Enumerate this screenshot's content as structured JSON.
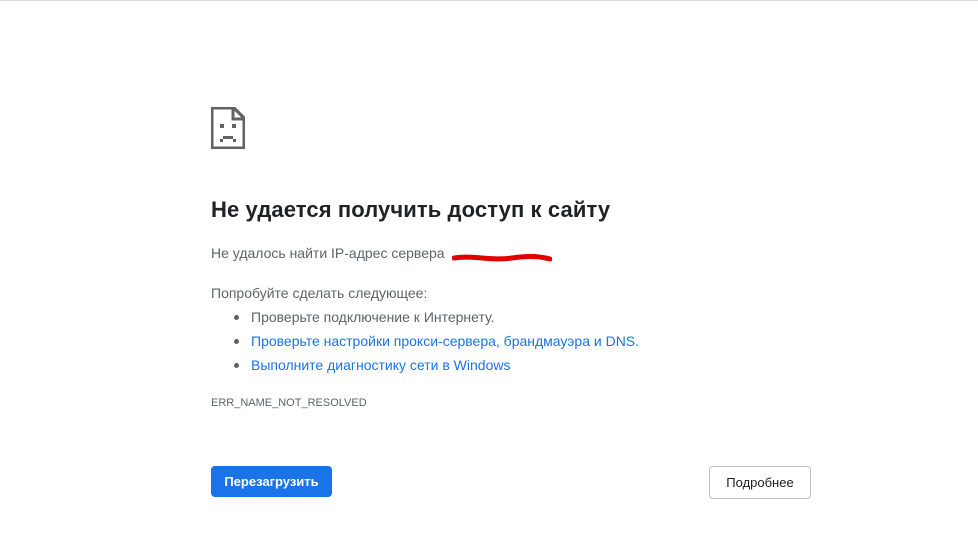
{
  "error_page": {
    "icon": "sad-page-icon",
    "title": "Не удается получить доступ к сайту",
    "subtitle": "Не удалось найти IP-адрес сервера",
    "try_title": "Попробуйте сделать следующее:",
    "suggestions": [
      {
        "label": "Проверьте подключение к Интернету.",
        "is_link": false
      },
      {
        "label": "Проверьте настройки прокси-сервера, брандмауэра и DNS.",
        "is_link": true
      },
      {
        "label": "Выполните диагностику сети в Windows",
        "is_link": true
      }
    ],
    "error_code": "ERR_NAME_NOT_RESOLVED"
  },
  "buttons": {
    "reload_label": "Перезагрузить",
    "details_label": "Подробнее"
  },
  "colors": {
    "accent": "#1a73e8",
    "text": "#202124",
    "secondary_text": "#5f6368",
    "redaction": "#e00000"
  }
}
